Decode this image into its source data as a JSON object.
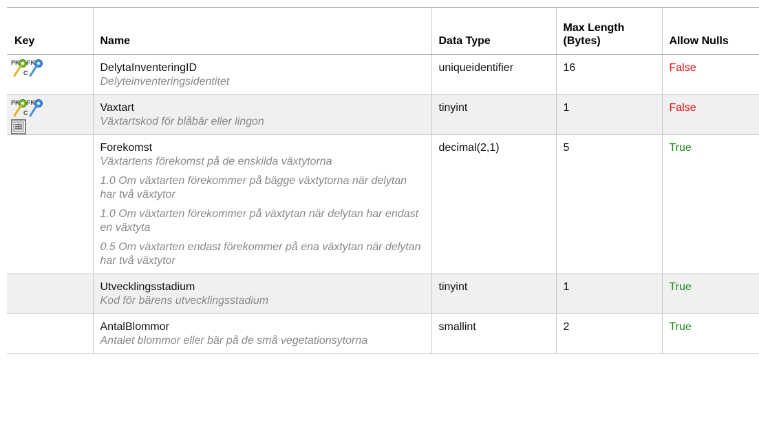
{
  "headers": {
    "key": "Key",
    "name": "Name",
    "data_type": "Data Type",
    "max_length_line1": "Max Length",
    "max_length_line2": "(Bytes)",
    "allow_nulls": "Allow Nulls"
  },
  "rows": [
    {
      "name": "DelytaInventeringID",
      "description": "Delyteinventeringsidentitet",
      "data_type": "uniqueidentifier",
      "max_length": "16",
      "allow_nulls": "False",
      "icons": [
        "pk-fk-c-key-icon"
      ]
    },
    {
      "name": "Vaxtart",
      "description": "Växtartskod för blåbär eller lingon",
      "data_type": "tinyint",
      "max_length": "1",
      "allow_nulls": "False",
      "icons": [
        "pk-fk-c-key-icon",
        "index-icon"
      ]
    },
    {
      "name": "Forekomst",
      "description": "Växtartens förekomst på de enskilda växtytorna",
      "notes": [
        "1.0 Om växtarten förekommer på bägge växtytorna när delytan har två växtytor",
        "1.0 Om växtarten förekommer på växtytan när delytan har endast en växtyta",
        "0.5 Om växtarten endast förekommer på ena växtytan när delytan har två växtytor"
      ],
      "data_type": "decimal(2,1)",
      "max_length": "5",
      "allow_nulls": "True"
    },
    {
      "name": "Utvecklingsstadium",
      "description": "Kod för bärens utvecklingsstadium",
      "data_type": "tinyint",
      "max_length": "1",
      "allow_nulls": "True"
    },
    {
      "name": "AntalBlommor",
      "description": "Antalet blommor eller bär på de små vegetationsytorna",
      "data_type": "smallint",
      "max_length": "2",
      "allow_nulls": "True"
    }
  ],
  "colors": {
    "false": "#e01010",
    "true": "#1a8a1a",
    "description": "#888888",
    "row_shade": "#f0f0f0"
  }
}
